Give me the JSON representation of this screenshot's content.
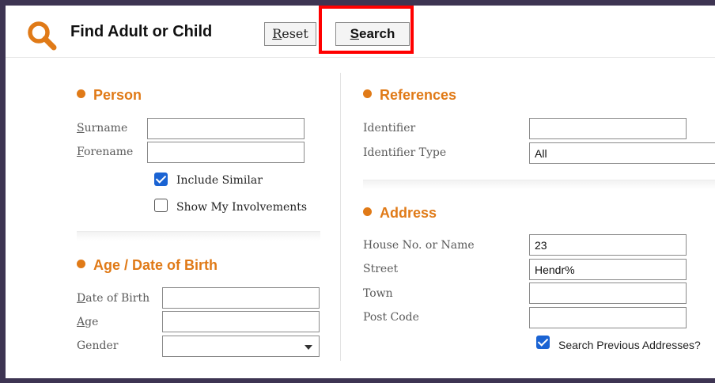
{
  "header": {
    "title": "Find Adult or Child",
    "reset_first": "R",
    "reset_rest": "eset",
    "search_first": "S",
    "search_rest": "earch"
  },
  "person": {
    "title": "Person",
    "surname_first": "S",
    "surname_rest": "urname",
    "surname_value": "",
    "forename_first": "F",
    "forename_rest": "orename",
    "forename_value": "",
    "include_similar_label": "Include Similar",
    "show_involvements_label": "Show My Involvements"
  },
  "age": {
    "title": "Age / Date of Birth",
    "dob_first": "D",
    "dob_rest": "ate of Birth",
    "dob_value": "",
    "age_first": "A",
    "age_rest": "ge",
    "age_value": "",
    "gender_label": "Gender",
    "gender_value": ""
  },
  "references": {
    "title": "References",
    "identifier_label": "Identifier",
    "identifier_value": "",
    "identifier_type_label": "Identifier Type",
    "identifier_type_value": "All"
  },
  "address": {
    "title": "Address",
    "house_label": "House No. or Name",
    "house_value": "23",
    "street_label": "Street",
    "street_value": "Hendr%",
    "town_label": "Town",
    "town_value": "",
    "postcode_label": "Post Code",
    "postcode_value": "",
    "search_previous_label": "Search Previous Addresses?"
  },
  "colors": {
    "accent": "#e07a17",
    "highlight": "#ff0000",
    "checkbox": "#1a63d3",
    "frame": "#3d3452"
  }
}
